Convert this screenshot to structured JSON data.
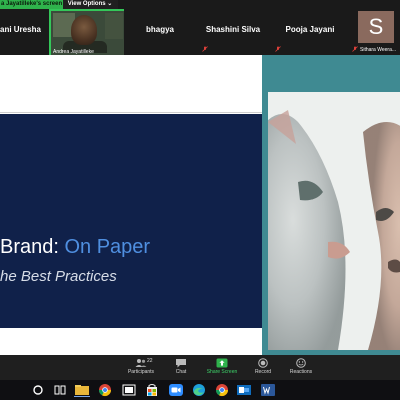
{
  "notice": {
    "share_text": "a Jayatilleke's screen",
    "view_options": "View Options ⌄"
  },
  "participants": [
    {
      "name": "ani Uresha"
    },
    {
      "name": "Andrea Jayatilleke",
      "caption": "Andrea Jayatilleke"
    },
    {
      "name": "bhagya"
    },
    {
      "name": "Shashini Silva"
    },
    {
      "name": "Pooja Jayani"
    },
    {
      "name": "Sithara Weera",
      "caption": "Sithara Weera...",
      "avatar_letter": "S"
    }
  ],
  "slide": {
    "title_main": "Brand: ",
    "title_accent": "On Paper",
    "subtitle": "he Best Practices"
  },
  "toolbar": {
    "participants_label": "Participants",
    "participants_count": "22",
    "chat_label": "Chat",
    "share_label": "Share Screen",
    "record_label": "Record",
    "reactions_label": "Reactions"
  },
  "colors": {
    "share_green": "#2fb24c",
    "slide_navy": "#10214a",
    "accent_blue": "#4f8fe0",
    "teal_bg": "#3f8a92",
    "muted_red": "#e0403a"
  },
  "icons": [
    "muted-mic-icon",
    "participants-icon",
    "chat-icon",
    "share-screen-icon",
    "record-icon",
    "reactions-icon",
    "start-icon",
    "search-icon",
    "task-view-icon",
    "file-explorer-icon",
    "chrome-icon",
    "store-icon",
    "zoom-icon",
    "edge-icon",
    "outlook-icon",
    "word-icon"
  ]
}
